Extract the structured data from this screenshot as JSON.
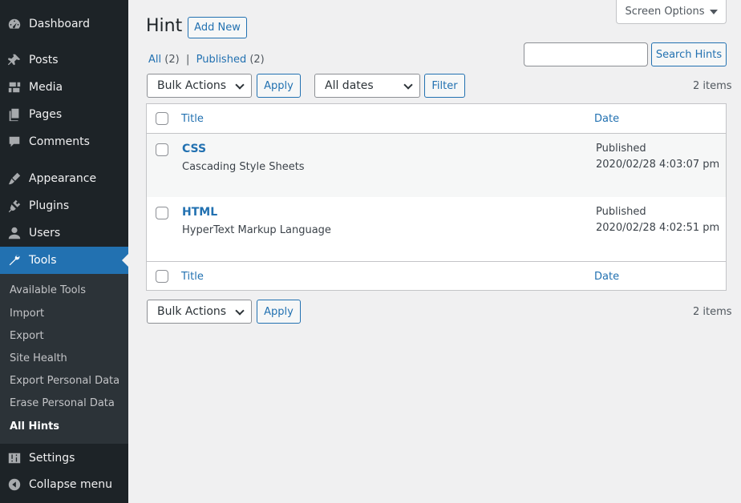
{
  "sidebar": {
    "items": [
      {
        "label": "Dashboard",
        "icon": "dashboard-icon"
      },
      {
        "label": "Posts",
        "icon": "pin-icon"
      },
      {
        "label": "Media",
        "icon": "media-icon"
      },
      {
        "label": "Pages",
        "icon": "pages-icon"
      },
      {
        "label": "Comments",
        "icon": "comment-icon"
      },
      {
        "label": "Appearance",
        "icon": "brush-icon"
      },
      {
        "label": "Plugins",
        "icon": "plug-icon"
      },
      {
        "label": "Users",
        "icon": "user-icon"
      },
      {
        "label": "Tools",
        "icon": "wrench-icon"
      },
      {
        "label": "Settings",
        "icon": "settings-icon"
      },
      {
        "label": "Collapse menu",
        "icon": "collapse-icon"
      }
    ],
    "submenu": [
      "Available Tools",
      "Import",
      "Export",
      "Site Health",
      "Export Personal Data",
      "Erase Personal Data",
      "All Hints"
    ]
  },
  "header": {
    "title": "Hint",
    "add_new": "Add New",
    "screen_options": "Screen Options"
  },
  "filters": {
    "all": "All",
    "all_count": "(2)",
    "separator": "|",
    "published": "Published",
    "published_count": "(2)"
  },
  "search": {
    "button": "Search Hints",
    "value": ""
  },
  "toolbar": {
    "bulk_actions": "Bulk Actions",
    "apply": "Apply",
    "dates": "All dates",
    "filter": "Filter",
    "count": "2 items"
  },
  "table": {
    "col_title": "Title",
    "col_date": "Date",
    "rows": [
      {
        "title": "CSS",
        "description": "Cascading Style Sheets",
        "status": "Published",
        "date": "2020/02/28 4:03:07 pm"
      },
      {
        "title": "HTML",
        "description": "HyperText Markup Language",
        "status": "Published",
        "date": "2020/02/28 4:02:51 pm"
      }
    ]
  },
  "colors": {
    "sidebar": "#1d2327",
    "accent": "#2271b1",
    "submenu": "#2c3338",
    "background": "#f0f0f1"
  }
}
